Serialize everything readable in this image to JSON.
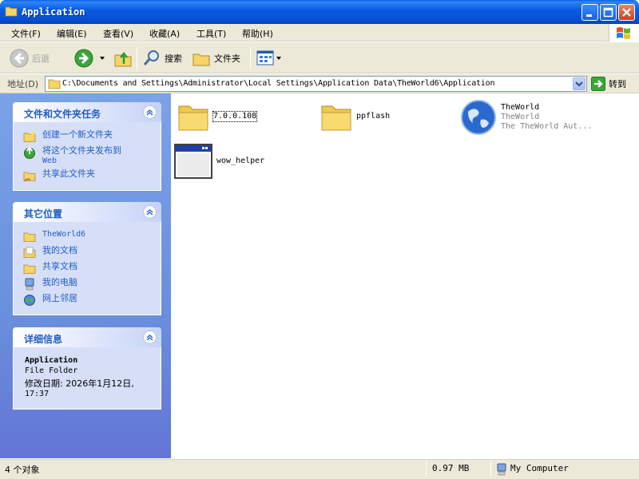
{
  "window": {
    "title": "Application"
  },
  "menu": [
    "文件(F)",
    "编辑(E)",
    "查看(V)",
    "收藏(A)",
    "工具(T)",
    "帮助(H)"
  ],
  "toolbar": {
    "back_label": "后退",
    "search_label": "搜索",
    "folders_label": "文件夹"
  },
  "address": {
    "label": "地址(D)",
    "path": "C:\\Documents and Settings\\Administrator\\Local Settings\\Application Data\\TheWorld6\\Application",
    "go_label": "转到"
  },
  "tasks_panel": {
    "title": "文件和文件夹任务",
    "items": [
      {
        "label": "创建一个新文件夹",
        "icon": "new-folder-icon"
      },
      {
        "label": "将这个文件夹发布到",
        "label2": "Web",
        "icon": "publish-web-icon"
      },
      {
        "label": "共享此文件夹",
        "icon": "share-folder-icon"
      }
    ]
  },
  "places_panel": {
    "title": "其它位置",
    "items": [
      {
        "label": "TheWorld6",
        "icon": "folder-icon"
      },
      {
        "label": "我的文档",
        "icon": "my-documents-icon"
      },
      {
        "label": "共享文档",
        "icon": "shared-documents-icon"
      },
      {
        "label": "我的电脑",
        "icon": "my-computer-icon"
      },
      {
        "label": "网上邻居",
        "icon": "network-icon"
      }
    ]
  },
  "details_panel": {
    "title": "详细信息",
    "name": "Application",
    "type": "File Folder",
    "modified_line1": "修改日期: 2026年1月12日,",
    "modified_line2": "17:37"
  },
  "files": [
    {
      "name": "7.0.0.108",
      "kind": "folder"
    },
    {
      "name": "ppflash",
      "kind": "folder"
    },
    {
      "name": "TheWorld",
      "line2": "TheWorld",
      "line3": "The TheWorld Aut...",
      "kind": "app"
    },
    {
      "name": "wow_helper",
      "kind": "window-app"
    }
  ],
  "status": {
    "objects": "4 个对象",
    "size": "0.97 MB",
    "location": "My Computer"
  }
}
